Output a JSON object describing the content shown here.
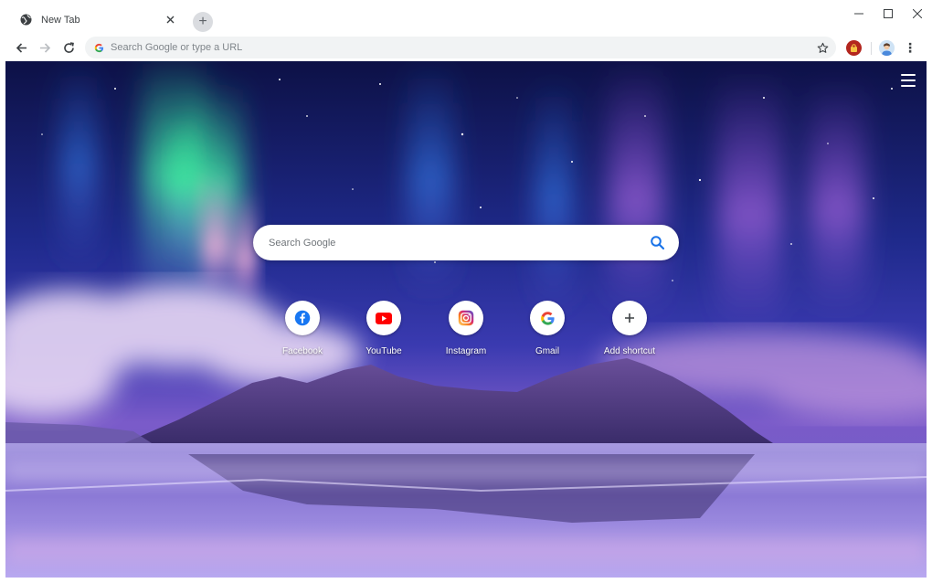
{
  "window": {
    "tab_title": "New Tab",
    "new_tab_symbol": "+",
    "controls": [
      "–",
      "☐",
      "✕"
    ]
  },
  "toolbar": {
    "back": "←",
    "forward": "→",
    "reload": "↻",
    "omnibox_placeholder": "Search Google or type a URL",
    "star": "☆",
    "menu": "⋮"
  },
  "page": {
    "search_placeholder": "Search Google",
    "shortcuts": [
      {
        "label": "Facebook",
        "icon": "facebook-icon",
        "color": "#1877f2"
      },
      {
        "label": "YouTube",
        "icon": "youtube-icon",
        "color": "#ff0000"
      },
      {
        "label": "Instagram",
        "icon": "instagram-icon",
        "color": "#c13584"
      },
      {
        "label": "Gmail",
        "icon": "google-icon",
        "color": "#4285f4"
      },
      {
        "label": "Add shortcut",
        "icon": "plus-icon",
        "color": "#3c4043"
      }
    ]
  },
  "colors": {
    "accent": "#1a73e8",
    "sky_top": "#0d1146",
    "aurora_green": "#3fe0a0",
    "aurora_pink": "#e8a0d8",
    "water": "#8c7ad6"
  }
}
